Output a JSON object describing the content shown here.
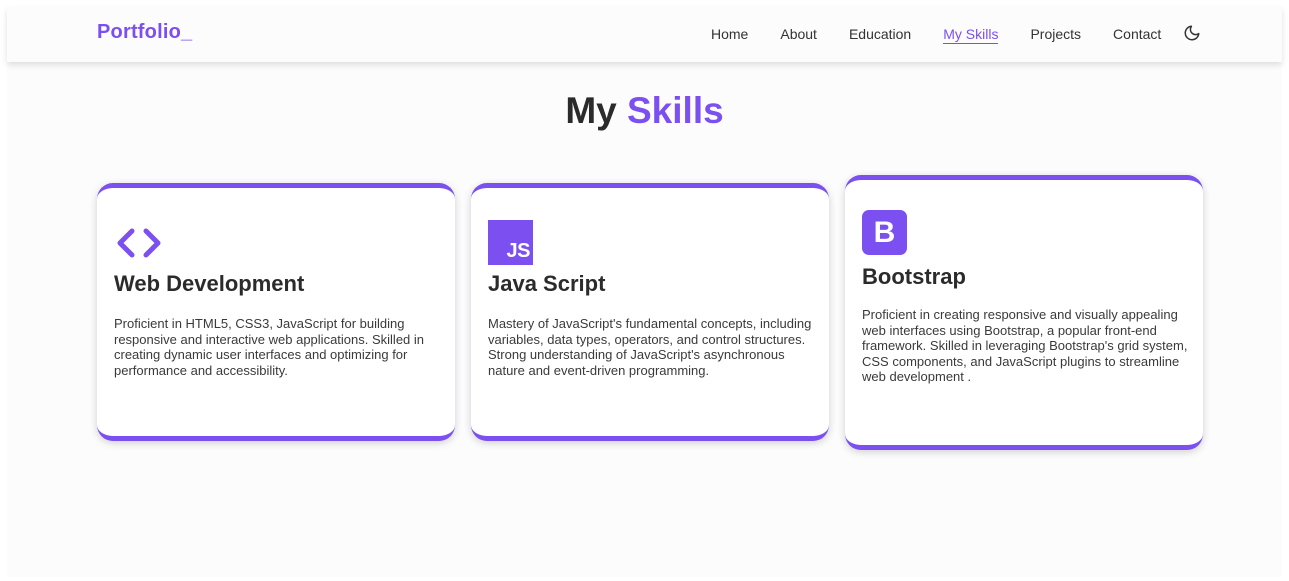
{
  "navbar": {
    "logo": "Portfolio_",
    "links": [
      {
        "label": "Home",
        "active": false
      },
      {
        "label": "About",
        "active": false
      },
      {
        "label": "Education",
        "active": false
      },
      {
        "label": "My Skills",
        "active": true
      },
      {
        "label": "Projects",
        "active": false
      },
      {
        "label": "Contact",
        "active": false
      }
    ],
    "theme_toggle_icon": "moon-icon"
  },
  "section": {
    "title_plain": "My",
    "title_accent": "Skills"
  },
  "skills": [
    {
      "icon": "code-icon",
      "title": "Web Development",
      "text": "Proficient in HTML5, CSS3, JavaScript for building responsive and interactive web applications. Skilled in creating dynamic user interfaces and optimizing for performance and accessibility."
    },
    {
      "icon": "javascript-icon",
      "icon_text": "JS",
      "title": "Java Script",
      "text": "Mastery of JavaScript's fundamental concepts, including variables, data types, operators, and control structures. Strong understanding of JavaScript's asynchronous nature and event-driven programming."
    },
    {
      "icon": "bootstrap-icon",
      "icon_text": "B",
      "title": "Bootstrap",
      "text": "Proficient in creating responsive and visually appealing web interfaces using Bootstrap, a popular front-end framework. Skilled in leveraging Bootstrap's grid system, CSS components, and JavaScript plugins to streamline web development ."
    }
  ],
  "colors": {
    "accent": "#7b4ff0",
    "text": "#2b2b2b",
    "background": "#fcfcfd"
  }
}
